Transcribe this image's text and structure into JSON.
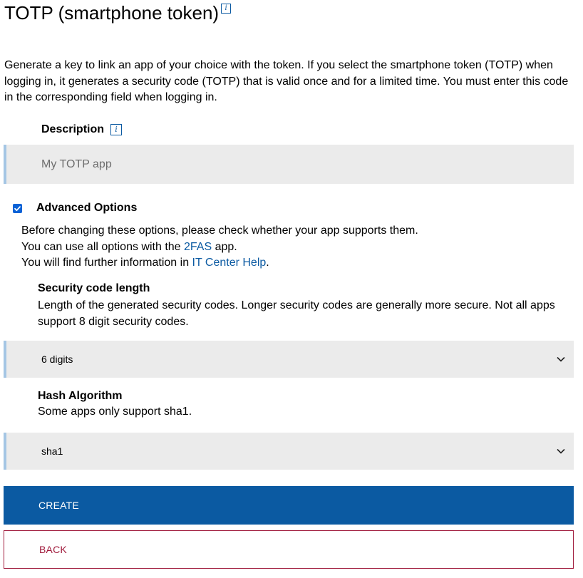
{
  "page": {
    "title": "TOTP (smartphone token)",
    "title_info_icon": "info-icon",
    "intro": "Generate a key to link an app of your choice with the token. If you select the smartphone token (TOTP) when logging in, it generates a security code (TOTP) that is valid once and for a limited time. You must enter this code in the corresponding field when logging in."
  },
  "description": {
    "label": "Description",
    "info_icon": "info-icon",
    "placeholder": "My TOTP app",
    "value": ""
  },
  "advanced": {
    "label": "Advanced Options",
    "checked": true,
    "line1": "Before changing these options, please check whether your app supports them.",
    "line2_prefix": "You can use all options with the ",
    "line2_link": "2FAS",
    "line2_suffix": " app.",
    "line3_prefix": "You will find further information in ",
    "line3_link": "IT Center Help",
    "line3_suffix": "."
  },
  "code_length": {
    "title": "Security code length",
    "description": "Length of the generated security codes. Longer security codes are generally more secure. Not all apps support 8 digit security codes.",
    "selected": "6 digits",
    "icon": "chevron-down-icon"
  },
  "hash": {
    "title": "Hash Algorithm",
    "description": "Some apps only support sha1.",
    "selected": "sha1",
    "icon": "chevron-down-icon"
  },
  "buttons": {
    "create": "CREATE",
    "back": "BACK"
  },
  "colors": {
    "primary": "#0b5aa2",
    "back_border": "#a11d3e",
    "input_bg": "#ebebeb",
    "input_accent": "#a4c6e4",
    "checkbox": "#0b62d6"
  }
}
